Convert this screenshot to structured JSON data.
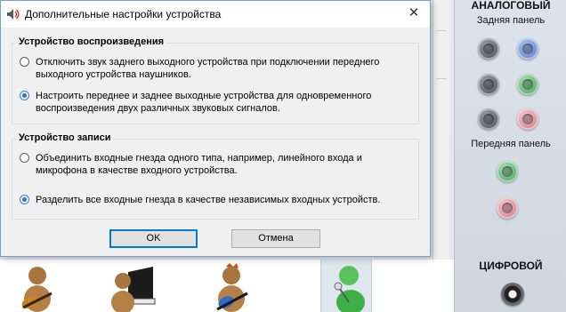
{
  "dialog": {
    "title": "Дополнительные настройки устройства",
    "close_glyph": "✕",
    "playback_group": {
      "title": "Устройство воспроизведения",
      "options": [
        {
          "label": "Отключить звук заднего выходного устройства при подключении переднего выходного устройства наушников.",
          "checked": false
        },
        {
          "label": "Настроить переднее и заднее выходные устройства для одновременного воспроизведения двух различных звуковых сигналов.",
          "checked": true
        }
      ]
    },
    "record_group": {
      "title": "Устройство записи",
      "options": [
        {
          "label": "Объединить входные гнезда одного типа, например, линейного входа и микрофона в качестве входного устройства.",
          "checked": false
        },
        {
          "label": "Разделить все входные гнезда в качестве независимых входных устройств.",
          "checked": true
        }
      ]
    },
    "ok_label": "OK",
    "cancel_label": "Отмена"
  },
  "right_panel": {
    "analog_heading": "АНАЛОГОВЫЙ",
    "rear_label": "Задняя панель",
    "rear_jacks": [
      "gray",
      "blue",
      "gray",
      "green",
      "gray",
      "pink"
    ],
    "front_label": "Передняя панель",
    "front_jacks": [
      "green",
      "pink"
    ],
    "digital_heading": "ЦИФРОВОЙ"
  },
  "colors": {
    "accent": "#0078d7",
    "jack_gray": "#6f757b",
    "jack_blue": "#7f9ddc",
    "jack_green": "#6fbf83",
    "jack_pink": "#e3a1ad"
  },
  "icons": {
    "title": "speaker-icon",
    "musicians": [
      "guitarist-icon",
      "pianist-icon",
      "guitarist-icon",
      "microphone-person-icon"
    ],
    "digital": "optical-jack-icon"
  }
}
